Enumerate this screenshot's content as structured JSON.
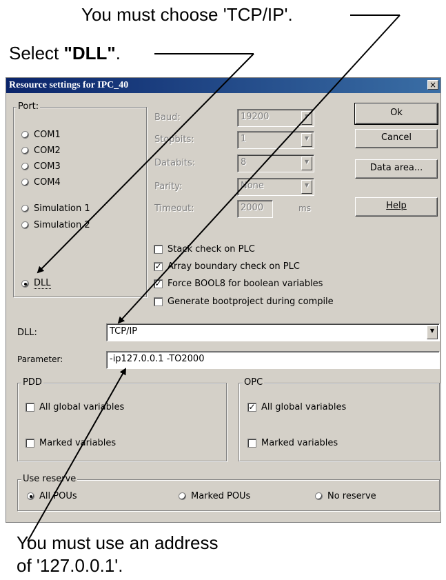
{
  "annotations": {
    "tcpip_note": "You must choose 'TCP/IP'.",
    "dll_note_prefix": "Select ",
    "dll_note_bold": "\"DLL\"",
    "dll_note_suffix": ".",
    "address_note_line1": "You must use an address",
    "address_note_line2": "of '127.0.0.1'."
  },
  "dialog": {
    "title": "Resource settings for IPC_40",
    "close_glyph": "×"
  },
  "port": {
    "legend": "Port:",
    "options": [
      "COM1",
      "COM2",
      "COM3",
      "COM4",
      "Simulation 1",
      "Simulation 2",
      "DLL"
    ],
    "selected": "DLL"
  },
  "serial": {
    "baud_label": "Baud:",
    "baud_value": "19200",
    "stopbits_label": "Stopbits:",
    "stopbits_value": "1",
    "databits_label": "Databits:",
    "databits_value": "8",
    "parity_label": "Parity:",
    "parity_value": "None",
    "timeout_label": "Timeout:",
    "timeout_value": "2000",
    "timeout_unit": "ms"
  },
  "buttons": {
    "ok": "Ok",
    "cancel": "Cancel",
    "data_area": "Data area...",
    "help": "Help"
  },
  "options": {
    "stack_check": "Stack check on PLC",
    "stack_check_checked": false,
    "array_check": "Array boundary check on PLC",
    "array_check_checked": true,
    "force_bool8": "Force BOOL8 for boolean variables",
    "force_bool8_checked": true,
    "bootproject": "Generate bootproject during compile",
    "bootproject_checked": false
  },
  "dll": {
    "label": "DLL:",
    "value": "TCP/IP"
  },
  "parameter": {
    "label": "Parameter:",
    "value": "-ip127.0.0.1 -TO2000"
  },
  "pdd": {
    "legend": "PDD",
    "all_global": "All global variables",
    "all_global_checked": false,
    "marked": "Marked variables",
    "marked_checked": false
  },
  "opc": {
    "legend": "OPC",
    "all_global": "All global variables",
    "all_global_checked": true,
    "marked": "Marked variables",
    "marked_checked": false
  },
  "reserve": {
    "legend": "Use reserve",
    "options": [
      "All POUs",
      "Marked POUs",
      "No reserve"
    ],
    "selected": "All POUs"
  },
  "colors": {
    "dialog_bg": "#d4d0c8",
    "title_bar": "#0a246a",
    "arrow": "#000000"
  }
}
